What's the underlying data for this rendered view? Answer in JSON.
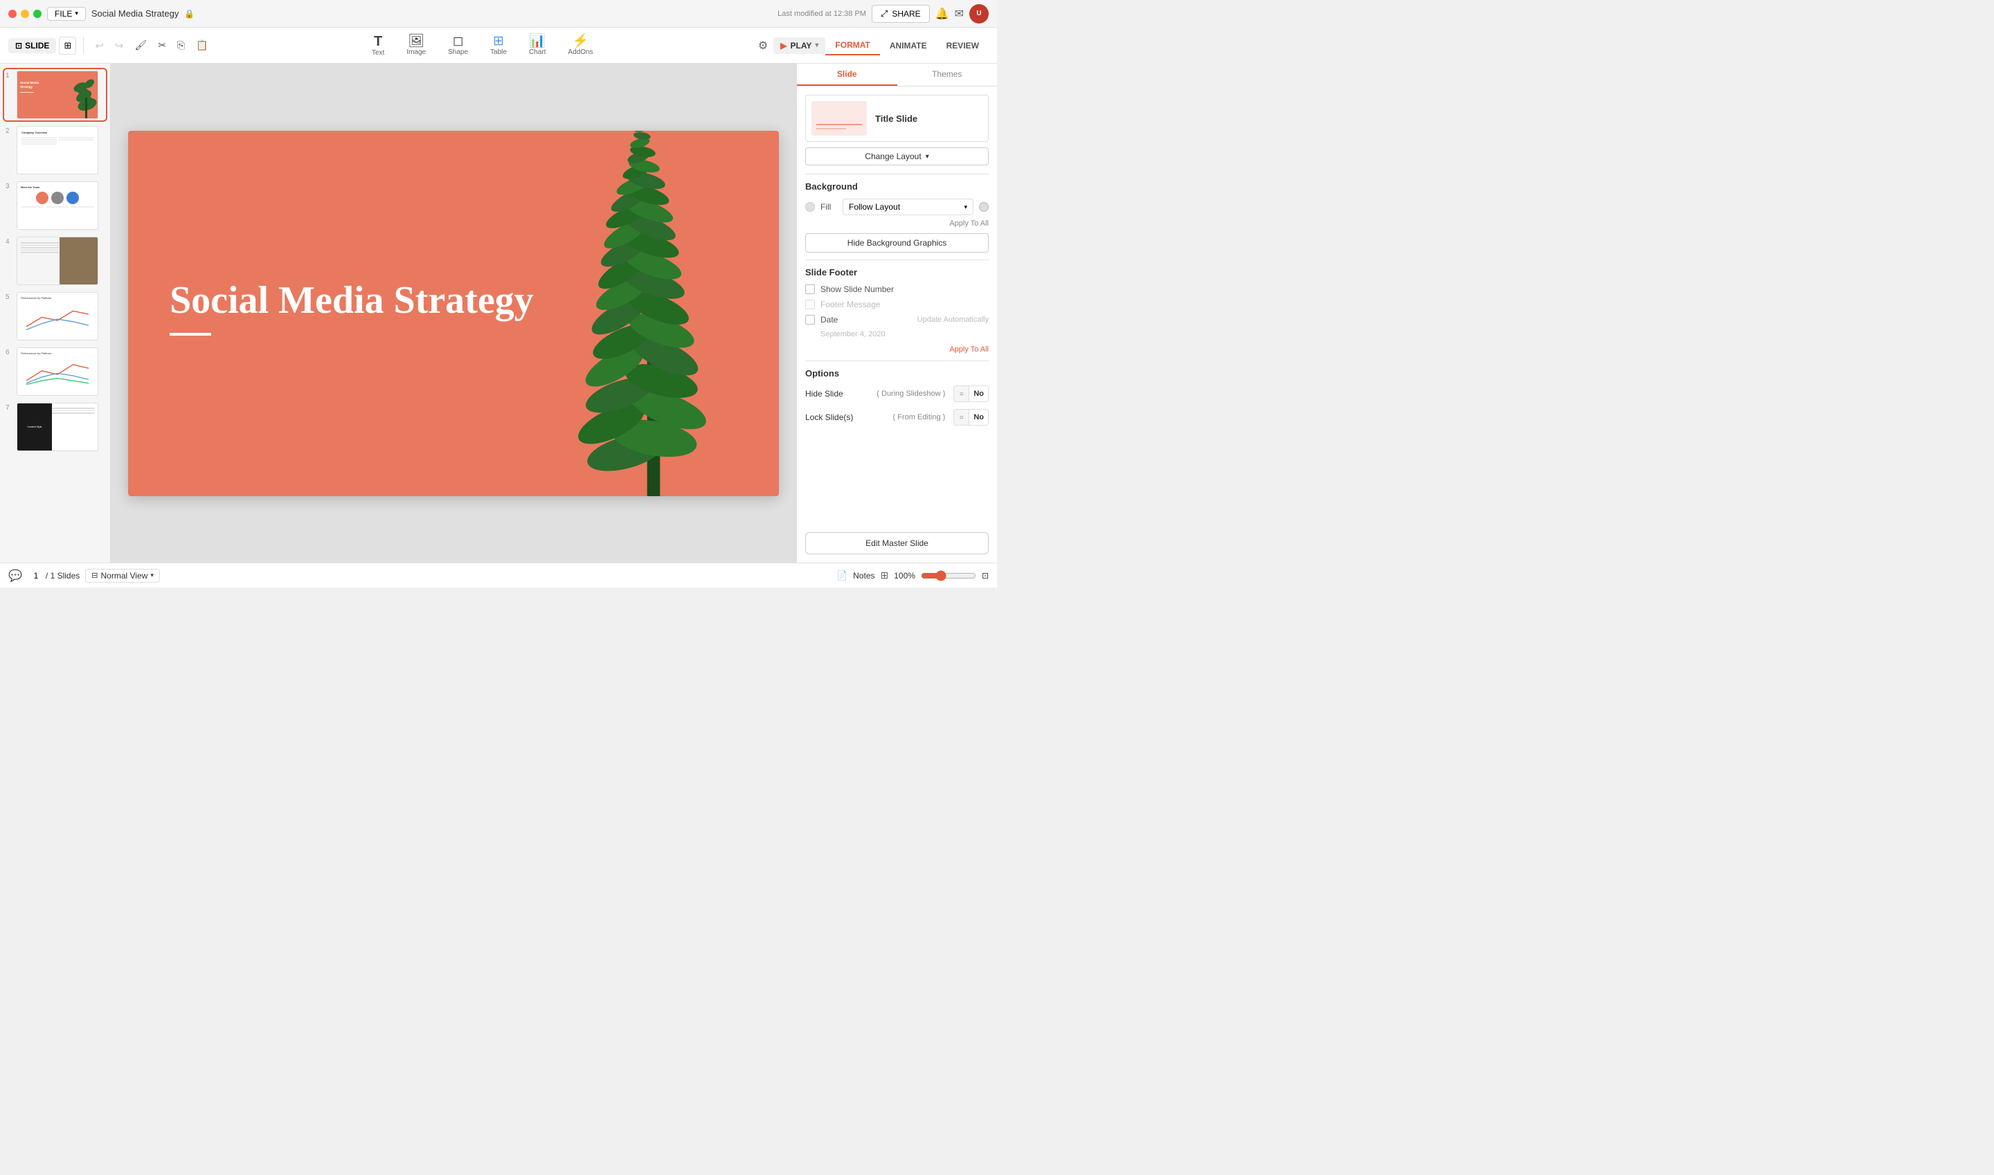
{
  "titlebar": {
    "file_label": "FILE",
    "doc_title": "Social Media Strategy",
    "last_modified": "Last modified at 12:38 PM",
    "share_label": "SHARE"
  },
  "toolbar": {
    "slide_label": "SLIDE",
    "undo_label": "↩",
    "redo_label": "↪",
    "tools": [
      {
        "id": "text",
        "icon": "T",
        "label": "Text"
      },
      {
        "id": "image",
        "icon": "🖼",
        "label": "Image"
      },
      {
        "id": "shape",
        "icon": "◻",
        "label": "Shape"
      },
      {
        "id": "table",
        "icon": "⊞",
        "label": "Table"
      },
      {
        "id": "chart",
        "icon": "📊",
        "label": "Chart"
      },
      {
        "id": "addons",
        "icon": "⚡",
        "label": "AddOns"
      }
    ],
    "play_label": "PLAY",
    "format_label": "FORMAT",
    "animate_label": "ANIMATE",
    "review_label": "REVIEW"
  },
  "slide_panel": {
    "slides": [
      {
        "num": "1",
        "type": "title"
      },
      {
        "num": "2",
        "type": "company"
      },
      {
        "num": "3",
        "type": "team"
      },
      {
        "num": "4",
        "type": "content"
      },
      {
        "num": "5",
        "type": "chart1"
      },
      {
        "num": "6",
        "type": "chart2"
      },
      {
        "num": "7",
        "type": "content_style"
      }
    ]
  },
  "canvas": {
    "title": "Social Media Strategy"
  },
  "right_panel": {
    "tabs": [
      "Slide",
      "Themes"
    ],
    "active_tab": "Slide",
    "layout": {
      "title": "Title Slide",
      "change_layout_btn": "Change Layout"
    },
    "background": {
      "title": "Background",
      "fill_label": "Fill",
      "fill_dropdown": "Follow Layout",
      "apply_all": "Apply To All",
      "hide_bg_btn": "Hide Background Graphics"
    },
    "footer": {
      "title": "Slide Footer",
      "show_slide_number": "Show Slide Number",
      "footer_message": "Footer Message",
      "date_label": "Date",
      "update_auto": "Update Automatically",
      "date_value": "September 4, 2020",
      "apply_all": "Apply To All"
    },
    "options": {
      "title": "Options",
      "hide_slide_label": "Hide Slide",
      "hide_slide_sub": "( During Slideshow )",
      "hide_slide_toggle": "No",
      "lock_slide_label": "Lock Slide(s)",
      "lock_slide_sub": "( From Editing )",
      "lock_slide_toggle": "No"
    },
    "edit_master_btn": "Edit Master Slide"
  },
  "status_bar": {
    "page_current": "1",
    "page_total": "/ 1 Slides",
    "normal_view": "Normal View",
    "notes_label": "Notes",
    "zoom_level": "100%",
    "chevron_down": "▾"
  }
}
